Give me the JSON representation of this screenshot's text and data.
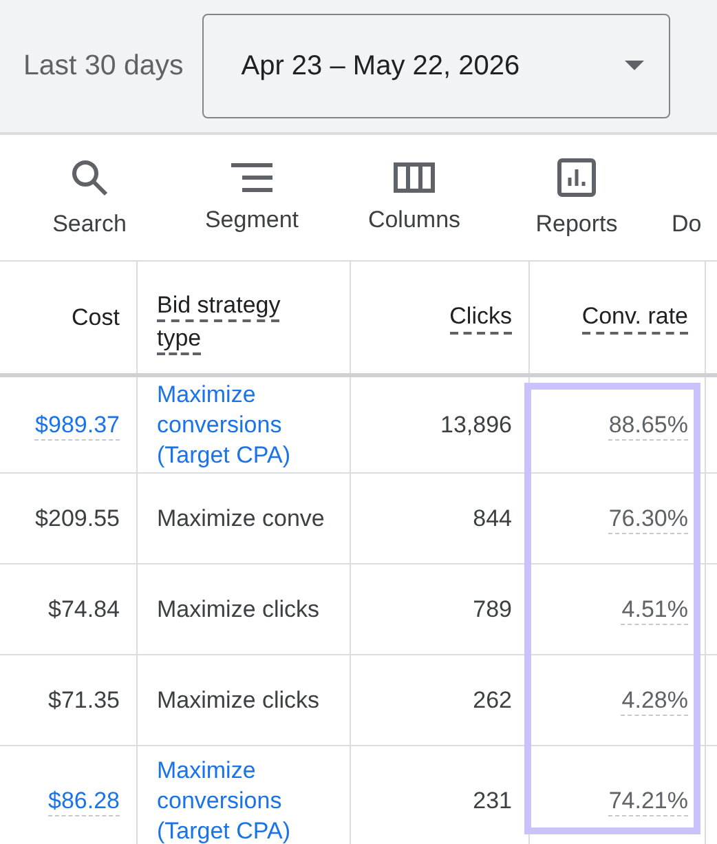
{
  "date_range": {
    "label": "Last 30 days",
    "value": "Apr 23 – May 22, 2026"
  },
  "toolbar": [
    "Search",
    "Segment",
    "Columns",
    "Reports",
    "Do"
  ],
  "table": {
    "columns": [
      {
        "label": "Cost",
        "highlighted": false
      },
      {
        "label": "Bid strategy type",
        "highlighted": false
      },
      {
        "label": "Clicks",
        "highlighted": false
      },
      {
        "label": "Conv. rate",
        "highlighted": true
      }
    ],
    "rows": [
      {
        "kind": "link",
        "cost": "$989.37",
        "strategy": "Maximize conversions (Target CPA)",
        "clicks": "13,896",
        "conv_rate": "88.65%"
      },
      {
        "kind": "plain",
        "cost": "$209.55",
        "strategy": "Maximize conve",
        "clicks": "844",
        "conv_rate": "76.30%"
      },
      {
        "kind": "plain",
        "cost": "$74.84",
        "strategy": "Maximize clicks",
        "clicks": "789",
        "conv_rate": "4.51%"
      },
      {
        "kind": "plain",
        "cost": "$71.35",
        "strategy": "Maximize clicks",
        "clicks": "262",
        "conv_rate": "4.28%"
      },
      {
        "kind": "link",
        "cost": "$86.28",
        "strategy": "Maximize conversions (Target CPA)",
        "clicks": "231",
        "conv_rate": "74.21%"
      }
    ]
  }
}
